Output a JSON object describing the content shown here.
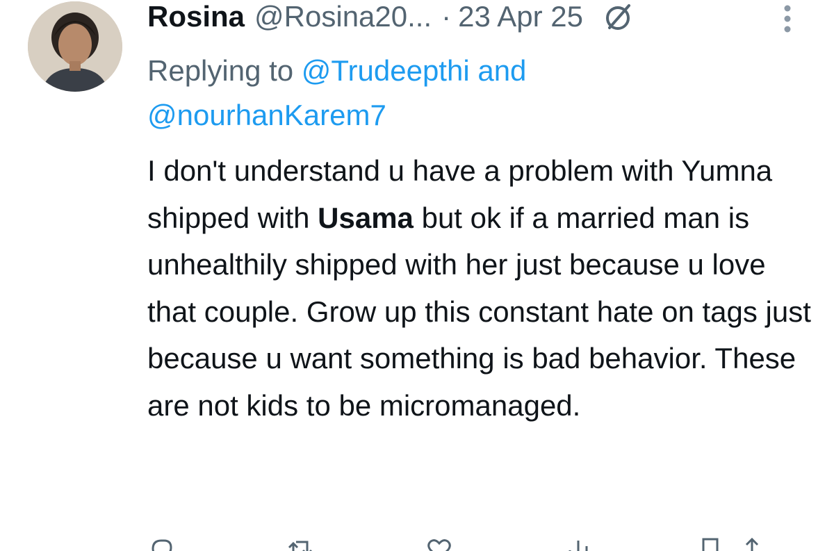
{
  "tweet": {
    "display_name": "Rosina",
    "handle": "@Rosina20...",
    "separator": "·",
    "date": "23 Apr 25",
    "replying_prefix": "Replying to",
    "replying_mention_1": "@Trudeepthi",
    "replying_and": "and",
    "replying_mention_2": "@nourhanKarem7",
    "body_part1": "I don't understand u have a problem with Yumna shipped with",
    "body_bold": "Usama",
    "body_part2": "but ok if a married man is unhealthily shipped with her just because u love that couple. Grow up this constant hate on tags just because u want something is bad behavior. These are not kids to be micromanaged."
  },
  "icons": {
    "badge": "verified-badge-icon",
    "more": "more-vertical-icon",
    "reply": "reply-icon",
    "retweet": "retweet-icon",
    "like": "like-icon",
    "views": "views-icon",
    "bookmark": "bookmark-icon",
    "share": "share-icon"
  },
  "colors": {
    "text": "#0f1419",
    "secondary": "#536471",
    "link": "#1d9bf0"
  }
}
